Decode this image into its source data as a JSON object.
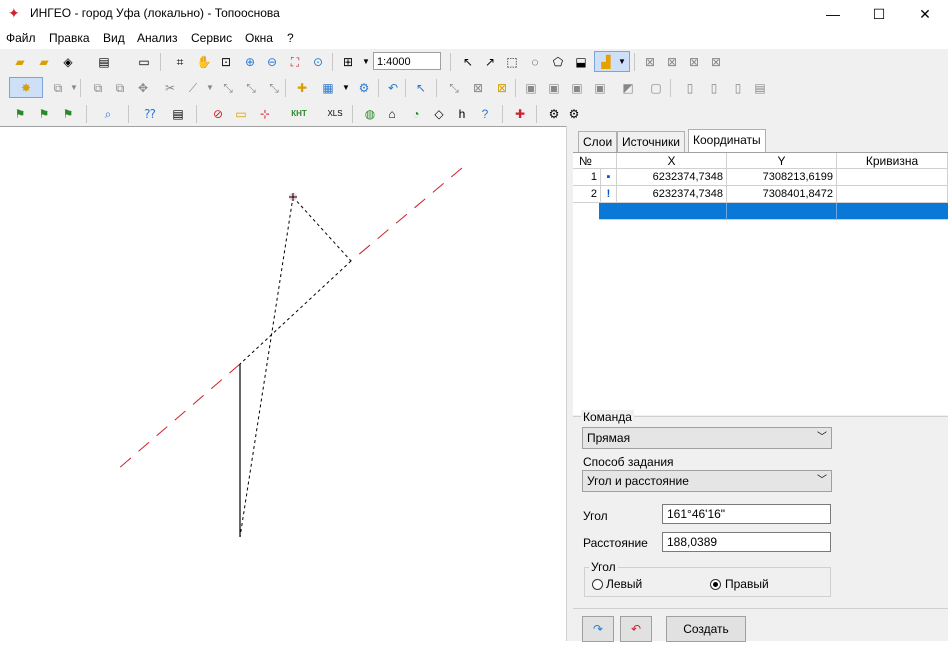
{
  "window": {
    "title": "ИНГЕО - город Уфа (локально) - Топооснова",
    "minimize": "—",
    "maximize": "☐",
    "close": "✕"
  },
  "menu": [
    "Файл",
    "Правка",
    "Вид",
    "Анализ",
    "Сервис",
    "Окна",
    "?"
  ],
  "toolbar": {
    "scale": "1:4000",
    "xls_label": "XLS",
    "knt_label": "КНТ"
  },
  "panel": {
    "tabs": [
      "Слои",
      "Источники",
      "Координаты"
    ],
    "active_tab": "Координаты",
    "table": {
      "headers": [
        "№",
        "X",
        "Y",
        "Кривизна"
      ],
      "rows": [
        {
          "num": "1",
          "marker": "▪",
          "x": "6232374,7348",
          "y": "7308213,6199",
          "curv": ""
        },
        {
          "num": "2",
          "marker": "!",
          "x": "6232374,7348",
          "y": "7308401,8472",
          "curv": ""
        }
      ]
    },
    "command_group_label": "Команда",
    "command_value": "Прямая",
    "method_label": "Способ задания",
    "method_value": "Угол и расстояние",
    "angle_label": "Угол",
    "angle_value": "161°46'16\"",
    "distance_label": "Расстояние",
    "distance_value": "188,0389",
    "angle_group_label": "Угол",
    "radio_left": "Левый",
    "radio_right": "Правый",
    "radio_selected": "Правый",
    "create_button": "Создать"
  },
  "colors": {
    "selection": "#0a78d7",
    "dash_line": "#d0202a",
    "accent_orange": "#e8a000"
  }
}
